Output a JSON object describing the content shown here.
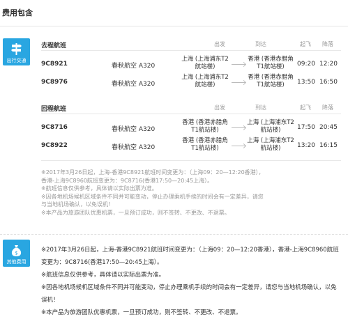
{
  "header": {
    "title": "费用包含"
  },
  "transport": {
    "icon_label": "出行交通",
    "outbound": {
      "title": "去程航班",
      "cols": {
        "depart": "出发",
        "arrive": "到达",
        "takeoff": "起飞",
        "land": "降落"
      },
      "rows": [
        {
          "flight": "9C8921",
          "airline": "春秋航空 A320",
          "from": [
            "上海 (上海浦东T2",
            "航站楼)"
          ],
          "to": [
            "香港 (香港赤腊角",
            "T1航站楼)"
          ],
          "dep": "09:20",
          "arr": "12:20"
        },
        {
          "flight": "9C8976",
          "airline": "春秋航空 A320",
          "from": [
            "上海 (上海浦东T2",
            "航站楼)"
          ],
          "to": [
            "香港 (香港赤腊角",
            "T1航站楼)"
          ],
          "dep": "13:50",
          "arr": "16:50"
        }
      ]
    },
    "return": {
      "title": "回程航班",
      "cols": {
        "depart": "出发",
        "arrive": "到达",
        "takeoff": "起飞",
        "land": "降落"
      },
      "rows": [
        {
          "flight": "9C8716",
          "airline": "春秋航空 A320",
          "from": [
            "香港 (香港赤腊角",
            "T1航站楼)"
          ],
          "to": [
            "上海 (上海浦东T2",
            "航站楼)"
          ],
          "dep": "17:50",
          "arr": "20:45"
        },
        {
          "flight": "9C8922",
          "airline": "春秋航空 A320",
          "from": [
            "香港 (香港赤腊角",
            "T1航站楼)"
          ],
          "to": [
            "上海 (上海浦东T2",
            "航站楼)"
          ],
          "dep": "13:20",
          "arr": "16:15"
        }
      ]
    },
    "notes": [
      "※2017年3月26日起，上海-香港9C8921航班时间变更为：（上海09：20—12:20香港），",
      "香港-上海9C8960航班变更为：9C8716(香港17:50—20:45上海）。",
      "※航班信息仅供参考，具体请以实际出票为准。",
      "※因各地机场候机区域条件不同并可能变动，停止办理乘机手续的时间会有一定差异，请您",
      "与当地机场确认，以免误机！",
      "※本产品为旅游团队优惠机票，一旦预订成功，则不签转、不更改、不退票。"
    ]
  },
  "other_fees": {
    "icon_label": "其他费用",
    "notes": [
      "※2017年3月26日起，上海-香港9C8921航班时间变更为：（上海09：20—12:20香港），香港-上海9C8960航班",
      "变更为：9C8716(香港17:50—20:45上海）。",
      "※航班信息仅供参考，具体请以实际出票为准。",
      "※因各地机场候机区域条件不同并可能变动，停止办理乘机手续的时间会有一定差异，请您与当地机场确认，以免",
      "误机！",
      "※本产品为旅游团队优惠机票，一旦预订成功，则不签转、不更改、不退票。"
    ]
  }
}
